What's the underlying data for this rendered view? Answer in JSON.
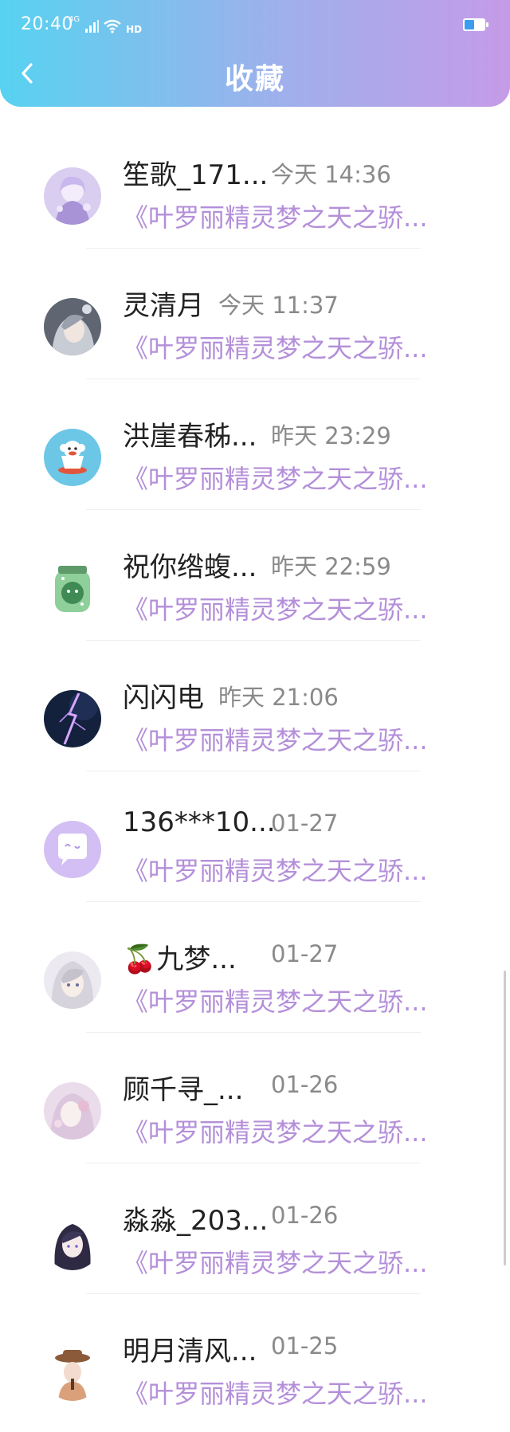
{
  "status_bar": {
    "time": "20:40",
    "network": "4G",
    "wifi_label": "HD"
  },
  "header": {
    "title": "收藏",
    "gradient_start": "#57d2f0",
    "gradient_end": "#c59be8"
  },
  "colors": {
    "book_title": "#b48fd9",
    "name": "#222222",
    "time": "#8a8a8a"
  },
  "favorites": [
    {
      "name": "笙歌_171...",
      "time": "今天 14:36",
      "book": "《叶罗丽精灵梦之天之骄...",
      "avatar": "anime-girl-avatar"
    },
    {
      "name": "灵清月",
      "time": "今天 11:37",
      "book": "《叶罗丽精灵梦之天之骄...",
      "avatar": "anime-character-avatar"
    },
    {
      "name": "洪崖春秭...",
      "time": "昨天 23:29",
      "book": "《叶罗丽精灵梦之天之骄...",
      "avatar": "monkey-cup-avatar"
    },
    {
      "name": "祝你绺蝮...",
      "time": "昨天 22:59",
      "book": "《叶罗丽精灵梦之天之骄...",
      "avatar": "green-jar-avatar"
    },
    {
      "name": "闪闪电",
      "time": "昨天 21:06",
      "book": "《叶罗丽精灵梦之天之骄...",
      "avatar": "lightning-avatar"
    },
    {
      "name": "136***10...",
      "time": "01-27",
      "book": "《叶罗丽精灵梦之天之骄...",
      "avatar": "chat-bubble-avatar"
    },
    {
      "name": "🍒九梦...",
      "time": "01-27",
      "book": "《叶罗丽精灵梦之天之骄...",
      "avatar": "anime-girl-white-hair-avatar"
    },
    {
      "name": "顾千寻_...",
      "time": "01-26",
      "book": "《叶罗丽精灵梦之天之骄...",
      "avatar": "anime-girl-pastel-avatar"
    },
    {
      "name": "淼淼_203...",
      "time": "01-26",
      "book": "《叶罗丽精灵梦之天之骄...",
      "avatar": "anime-girl-dark-hair-avatar"
    },
    {
      "name": "明月清风...",
      "time": "01-25",
      "book": "《叶罗丽精灵梦之天之骄...",
      "avatar": "girl-with-hat-avatar"
    }
  ]
}
